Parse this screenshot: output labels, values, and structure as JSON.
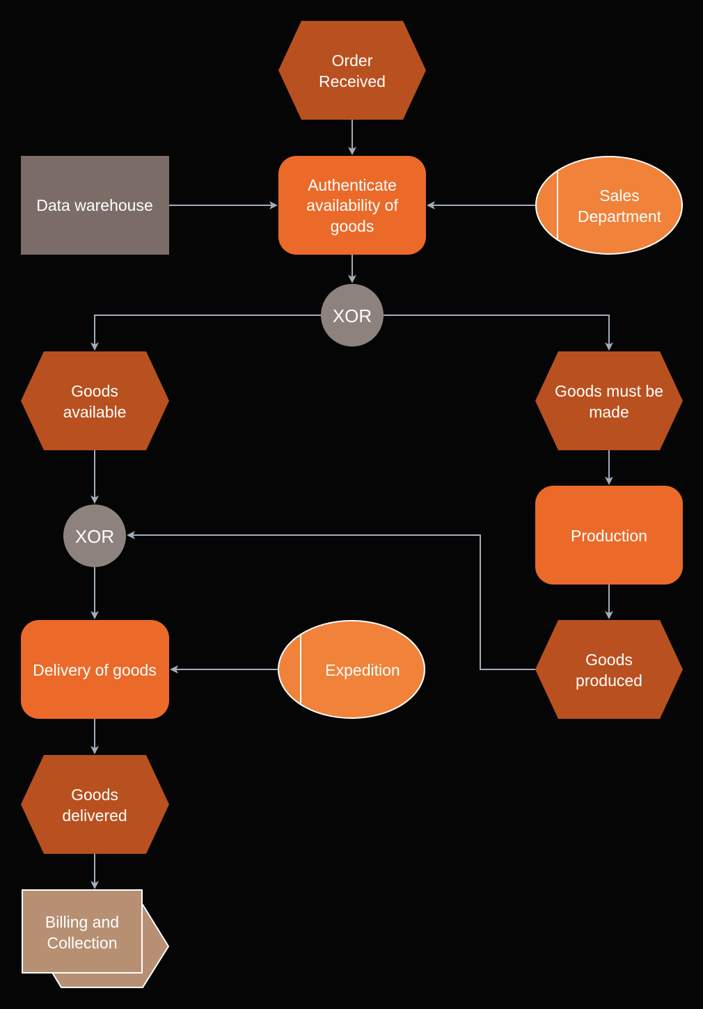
{
  "colors": {
    "event": "#b9501f",
    "function": "#eb6a29",
    "organization": "#f0823a",
    "connector": "#8d827e",
    "data": "#7b6c67",
    "process_path": "#b79074",
    "line": "#a3adbb"
  },
  "nodes": {
    "order_received": [
      "Order",
      "Received"
    ],
    "authenticate": [
      "Authenticate",
      "availability of",
      "goods"
    ],
    "data_warehouse": [
      "Data warehouse"
    ],
    "sales_department": [
      "Sales",
      "Department"
    ],
    "xor1": [
      "XOR"
    ],
    "goods_available": [
      "Goods",
      "available"
    ],
    "goods_must_be_made": [
      "Goods must be",
      "made"
    ],
    "production": [
      "Production"
    ],
    "xor2": [
      "XOR"
    ],
    "delivery_of_goods": [
      "Delivery of goods"
    ],
    "expedition": [
      "Expedition"
    ],
    "goods_produced": [
      "Goods",
      "produced"
    ],
    "goods_delivered": [
      "Goods",
      "delivered"
    ],
    "billing_and_collection": [
      "Billing and",
      "Collection"
    ]
  }
}
